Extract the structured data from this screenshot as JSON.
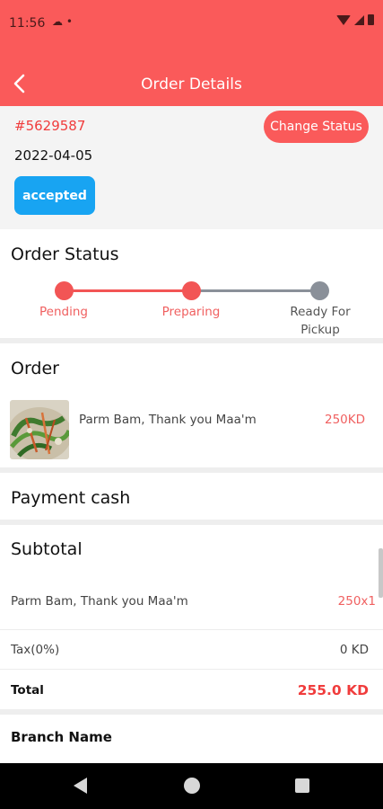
{
  "status_bar": {
    "time": "11:56"
  },
  "header": {
    "title": "Order Details"
  },
  "order": {
    "id": "#5629587",
    "date": "2022-04-05",
    "status_badge": "accepted",
    "change_status_label": "Change Status"
  },
  "order_status": {
    "title": "Order Status",
    "steps": [
      {
        "label": "Pending",
        "state": "done"
      },
      {
        "label": "Preparing",
        "state": "done"
      },
      {
        "label": "Ready For Pickup",
        "state": "pending"
      }
    ]
  },
  "order_section": {
    "title": "Order",
    "items": [
      {
        "name": "Parm Bam, Thank you Maa'm",
        "price": "250KD"
      }
    ]
  },
  "payment": {
    "label": "Payment cash"
  },
  "subtotal": {
    "title": "Subtotal",
    "line_item": {
      "name": "Parm Bam, Thank you Maa'm",
      "qty_price": "250x1"
    },
    "tax": {
      "label": "Tax(0%)",
      "value": "0 KD"
    },
    "total": {
      "label": "Total",
      "value": "255.0 KD"
    }
  },
  "branch": {
    "label": "Branch Name"
  },
  "colors": {
    "accent": "#fa5a5a",
    "badge": "#18a4f2",
    "step_active": "#f25555",
    "step_inactive": "#8a9099",
    "text_red": "#f03c3c"
  }
}
